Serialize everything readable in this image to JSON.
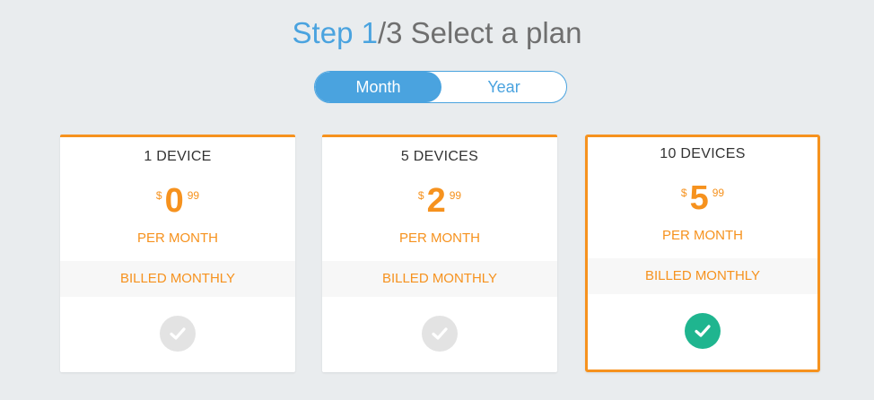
{
  "header": {
    "step_word": "Step",
    "step_num": "1",
    "step_rest": "/3 Select a plan"
  },
  "billing_toggle": {
    "options": [
      "Month",
      "Year"
    ],
    "selected": "Month"
  },
  "plans": [
    {
      "name": "1 DEVICE",
      "currency": "$",
      "price_main": "0",
      "price_cents": "99",
      "period": "PER MONTH",
      "billing": "BILLED MONTHLY",
      "selected": false
    },
    {
      "name": "5 DEVICES",
      "currency": "$",
      "price_main": "2",
      "price_cents": "99",
      "period": "PER MONTH",
      "billing": "BILLED MONTHLY",
      "selected": false
    },
    {
      "name": "10 DEVICES",
      "currency": "$",
      "price_main": "5",
      "price_cents": "99",
      "period": "PER MONTH",
      "billing": "BILLED MONTHLY",
      "selected": true
    }
  ],
  "icons": {
    "select": "check-icon"
  },
  "colors": {
    "accent_blue": "#4aa3df",
    "accent_orange": "#f6921e",
    "check_selected": "#1fb58f",
    "check_unselected": "#e3e3e3",
    "background": "#e9ecee"
  }
}
